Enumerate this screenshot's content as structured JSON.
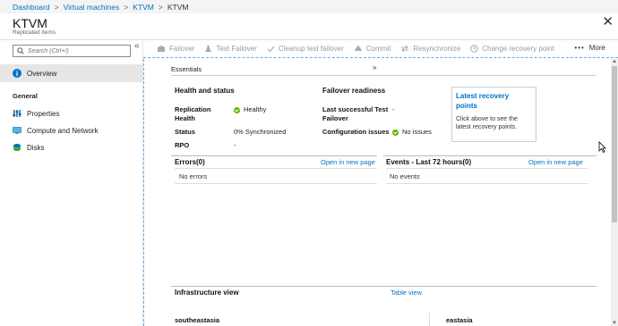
{
  "breadcrumb": [
    "Dashboard",
    "Virtual machines",
    "KTVM",
    "KTVM"
  ],
  "header": {
    "title": "KTVM",
    "subtitle": "Replicated items"
  },
  "sidebar": {
    "search_placeholder": "Search (Ctrl+/)",
    "items": [
      {
        "label": "Overview",
        "icon": "info-icon"
      },
      {
        "label": "Properties",
        "icon": "properties-icon"
      },
      {
        "label": "Compute and Network",
        "icon": "monitor-icon"
      },
      {
        "label": "Disks",
        "icon": "disk-icon"
      }
    ],
    "section": "General"
  },
  "toolbar": {
    "buttons": [
      {
        "label": "Failover",
        "icon": "failover-icon"
      },
      {
        "label": "Test Failover",
        "icon": "test-failover-icon"
      },
      {
        "label": "Cleanup test failover",
        "icon": "check-icon"
      },
      {
        "label": "Commit",
        "icon": "commit-icon"
      },
      {
        "label": "Resynchronize",
        "icon": "resync-icon"
      },
      {
        "label": "Change recovery point",
        "icon": "clock-icon"
      }
    ],
    "more": "More"
  },
  "essentials": {
    "label": "Essentials",
    "health": {
      "title": "Health and status",
      "replication_health_label": "Replication Health",
      "replication_health_value": "Healthy",
      "status_label": "Status",
      "status_value": "0% Synchronized",
      "rpo_label": "RPO",
      "rpo_value": "-"
    },
    "failover": {
      "title": "Failover readiness",
      "last_test_label": "Last successful Test Failover",
      "last_test_value": "-",
      "config_label": "Configuration issues",
      "config_value": "No issues"
    },
    "recovery": {
      "title": "Latest recovery points",
      "desc": "Click above to see the latest recovery points."
    }
  },
  "errors": {
    "title": "Errors(0)",
    "link": "Open in new page",
    "empty": "No errors"
  },
  "events": {
    "title": "Events - Last 72 hours(0)",
    "link": "Open in new page",
    "empty": "No events"
  },
  "infra": {
    "title": "Infrastructure view",
    "link": "Table view",
    "regions": [
      "southeastasia",
      "eastasia"
    ]
  },
  "colors": {
    "accent": "#0072c6",
    "healthy": "#5db300",
    "active_nav": "#e6e6e6"
  }
}
